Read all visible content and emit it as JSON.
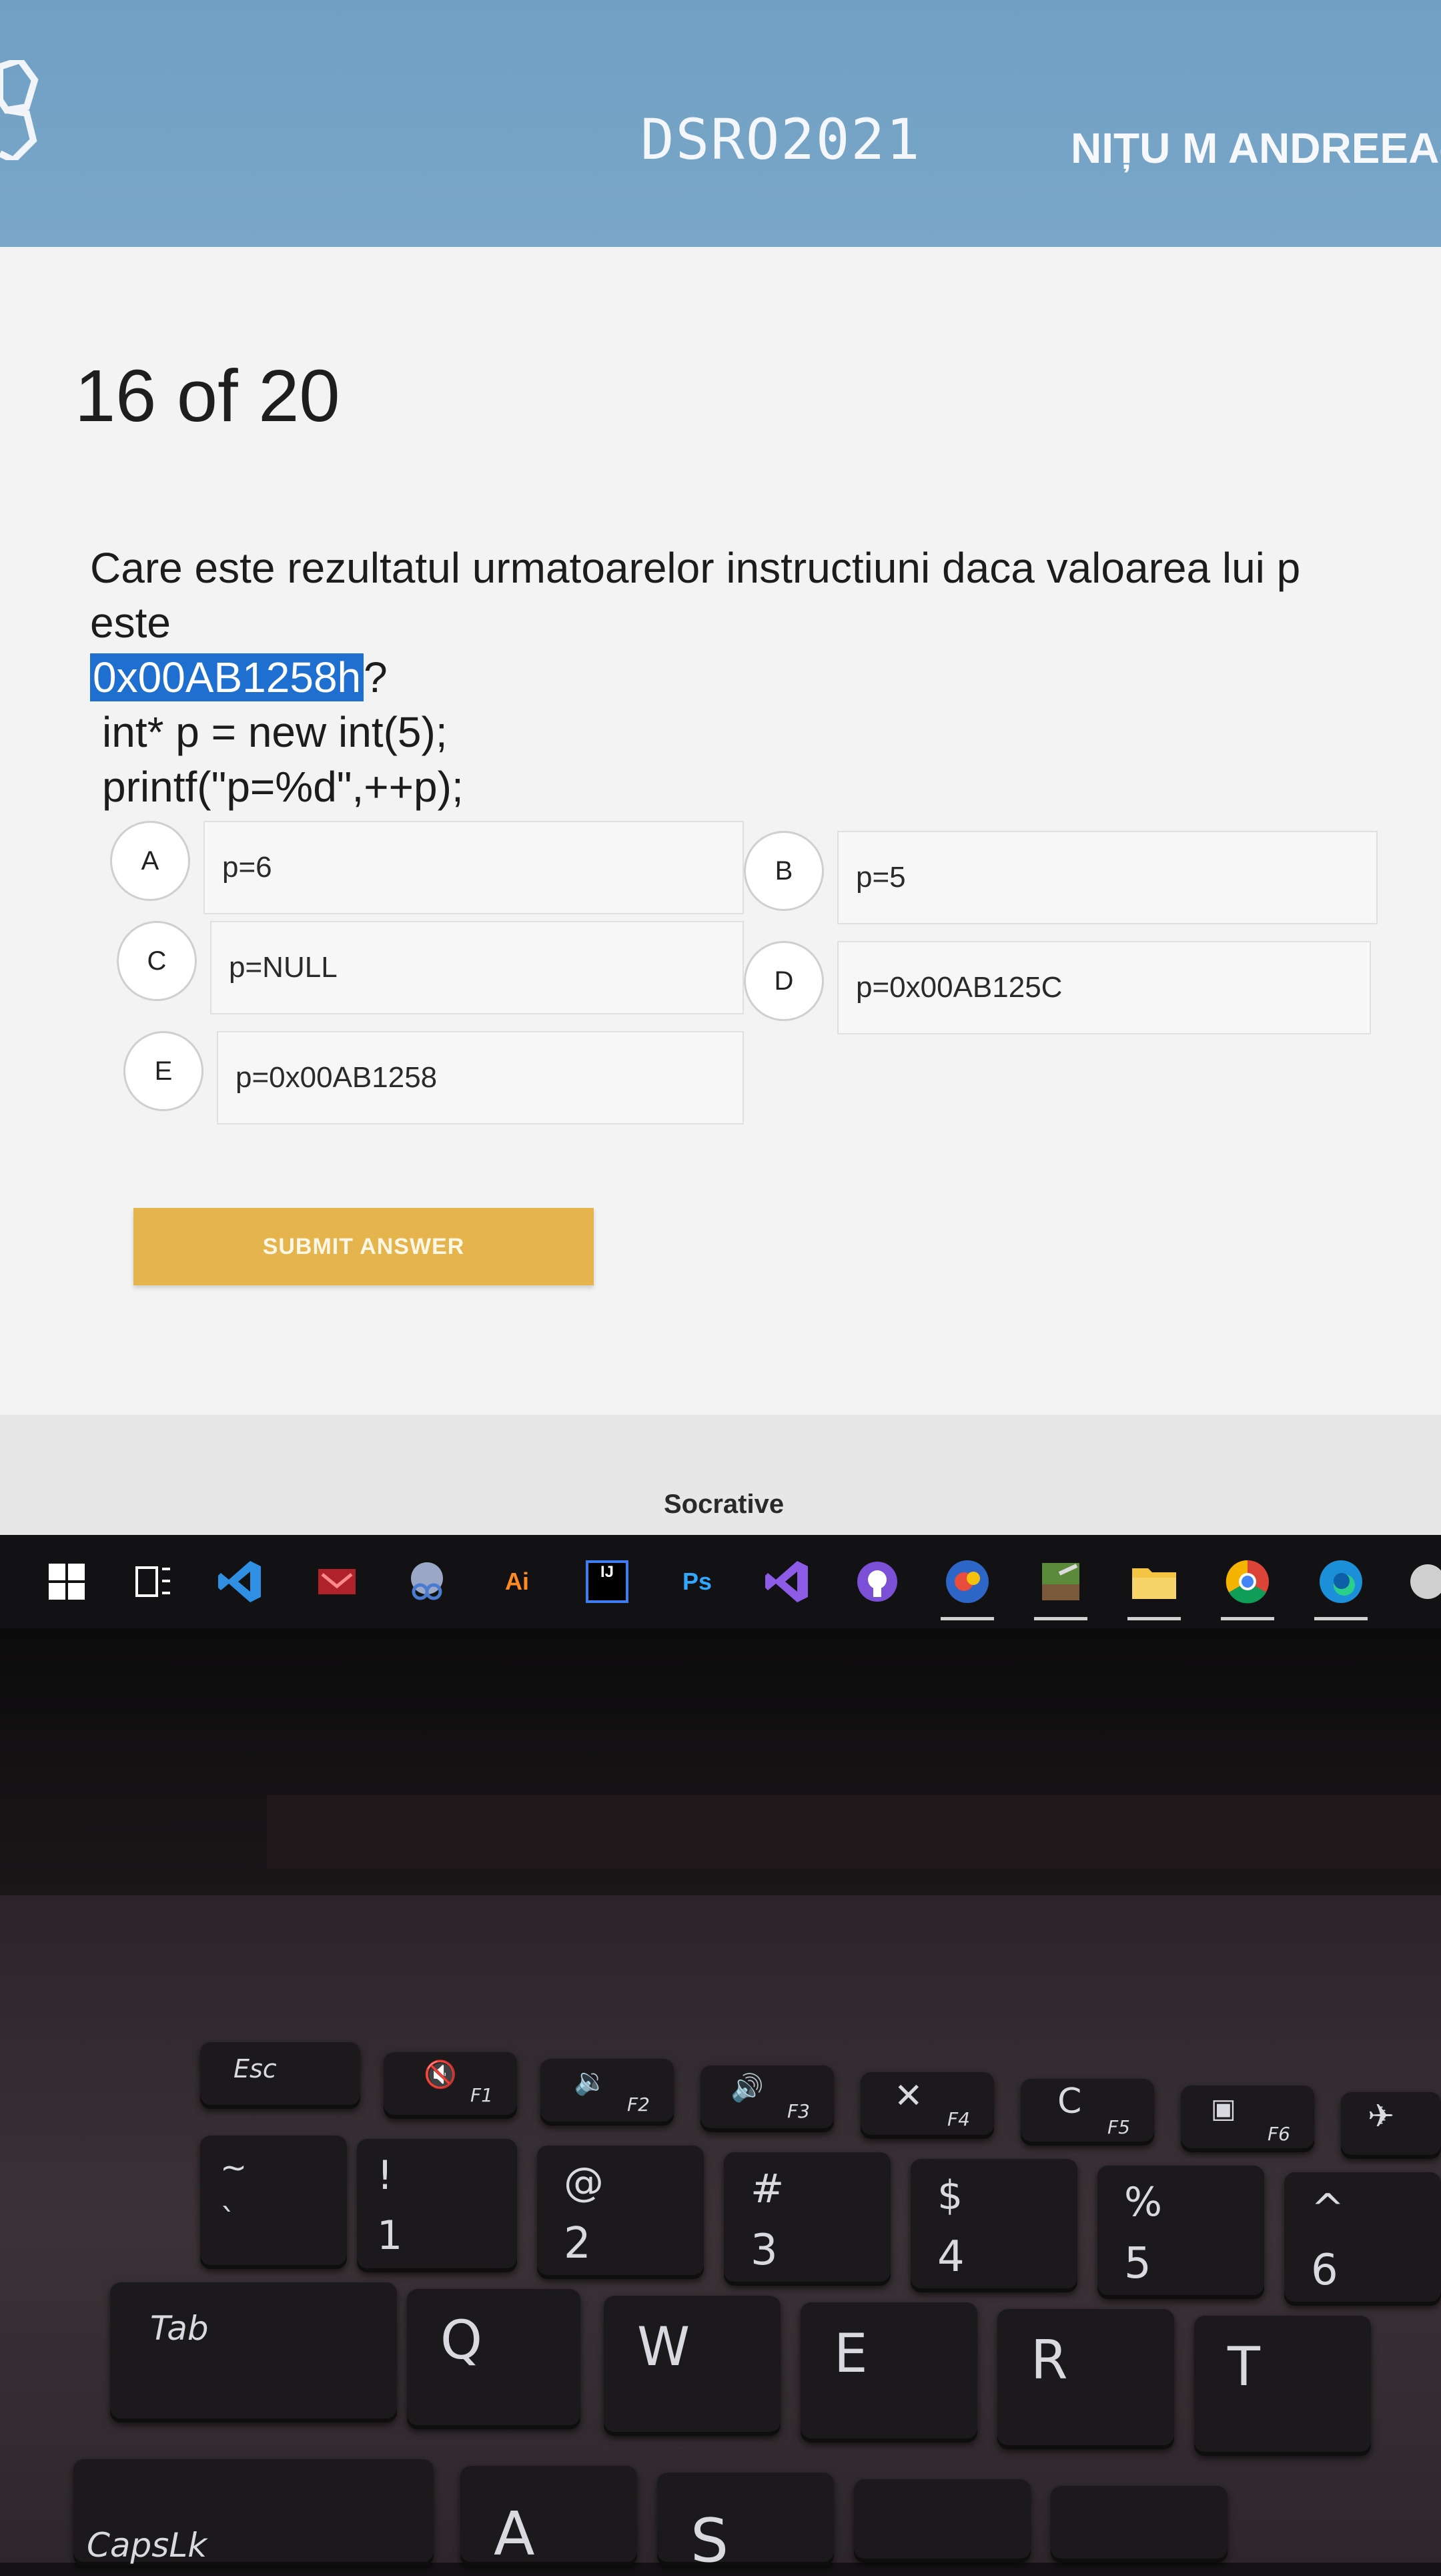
{
  "header": {
    "room_name": "DSRO2021",
    "student_name": "NIȚU M ANDREEA-B"
  },
  "quiz": {
    "progress": "16 of 20",
    "question_line1": "Care este rezultatul urmatoarelor instructiuni daca valoarea lui p este",
    "question_highlight": "0x00AB1258h",
    "question_mark": "?",
    "code_line1": "int* p = new int(5);",
    "code_line2": "printf(\"p=%d\",++p);",
    "choices": [
      {
        "letter": "A",
        "text": "p=6"
      },
      {
        "letter": "B",
        "text": "p=5"
      },
      {
        "letter": "C",
        "text": "p=NULL"
      },
      {
        "letter": "D",
        "text": "p=0x00AB125C"
      },
      {
        "letter": "E",
        "text": "p=0x00AB1258"
      }
    ],
    "submit_label": "SUBMIT ANSWER"
  },
  "footer": {
    "brand": "Socrative"
  },
  "taskbar": {
    "icons": [
      {
        "name": "windows-start-icon",
        "glyph": ""
      },
      {
        "name": "task-view-icon",
        "glyph": ""
      },
      {
        "name": "vscode-icon",
        "glyph": ""
      },
      {
        "name": "mail-app-icon",
        "glyph": ""
      },
      {
        "name": "snipping-tool-icon",
        "glyph": ""
      },
      {
        "name": "illustrator-icon",
        "glyph": "Ai"
      },
      {
        "name": "intellij-icon",
        "glyph": "IJ"
      },
      {
        "name": "photoshop-icon",
        "glyph": "Ps"
      },
      {
        "name": "visual-studio-icon",
        "glyph": ""
      },
      {
        "name": "github-desktop-icon",
        "glyph": ""
      },
      {
        "name": "chrome-profile-icon",
        "glyph": ""
      },
      {
        "name": "minecraft-icon",
        "glyph": ""
      },
      {
        "name": "file-explorer-icon",
        "glyph": ""
      },
      {
        "name": "chrome-icon",
        "glyph": ""
      },
      {
        "name": "edge-icon",
        "glyph": ""
      }
    ]
  },
  "keyboard": {
    "fn_row": [
      "Esc",
      "F1",
      "F2",
      "F3",
      "F4",
      "F5",
      "F6"
    ],
    "number_row": [
      {
        "top": "~",
        "bottom": "`"
      },
      {
        "top": "!",
        "bottom": "1"
      },
      {
        "top": "@",
        "bottom": "2"
      },
      {
        "top": "#",
        "bottom": "3"
      },
      {
        "top": "$",
        "bottom": "4"
      },
      {
        "top": "%",
        "bottom": "5"
      },
      {
        "top": "^",
        "bottom": "6"
      }
    ],
    "letter_row": [
      "Tab",
      "Q",
      "W",
      "E",
      "R",
      "T"
    ],
    "home_row": [
      "CapsLk",
      "A",
      "S"
    ]
  },
  "colors": {
    "header_blue": "#7aa7c8",
    "submit_gold": "#e5b44c",
    "highlight_blue": "#1f6fd1"
  }
}
